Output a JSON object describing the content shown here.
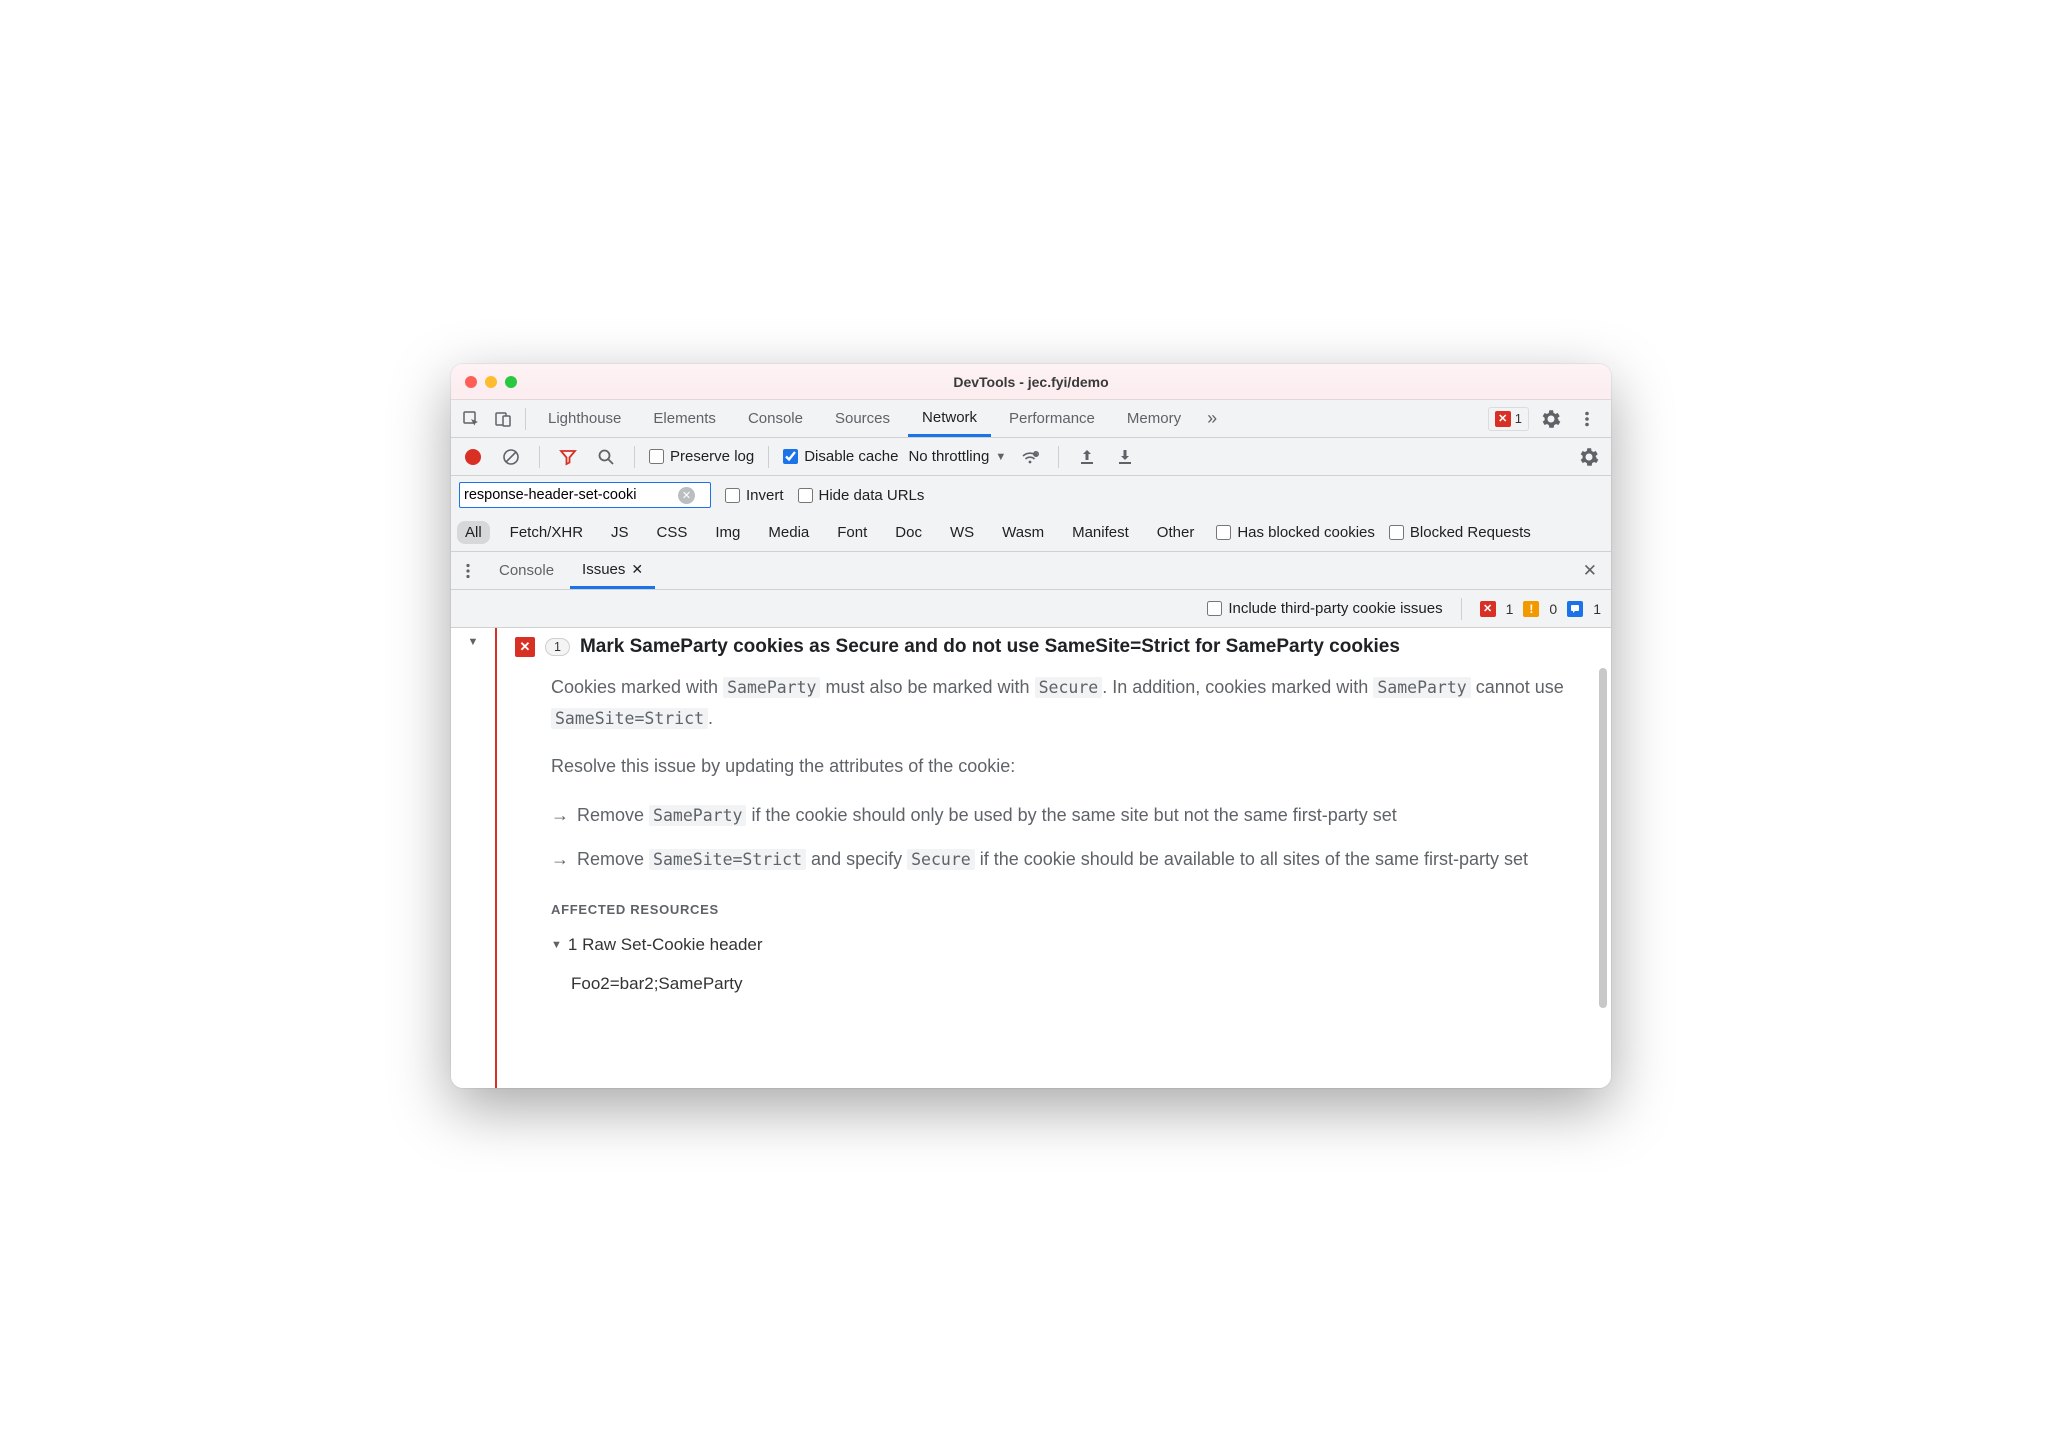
{
  "window": {
    "title": "DevTools - jec.fyi/demo"
  },
  "mainTabs": {
    "items": [
      "Lighthouse",
      "Elements",
      "Console",
      "Sources",
      "Network",
      "Performance",
      "Memory"
    ],
    "active": "Network",
    "overflow_icon": "»",
    "error_count": "1"
  },
  "netToolbar": {
    "preserve_log_label": "Preserve log",
    "preserve_log_checked": false,
    "disable_cache_label": "Disable cache",
    "disable_cache_checked": true,
    "throttling_label": "No throttling"
  },
  "filterBar": {
    "filter_value": "response-header-set-cooki",
    "invert_label": "Invert",
    "invert_checked": false,
    "hide_urls_label": "Hide data URLs",
    "hide_urls_checked": false
  },
  "typeFilters": {
    "items": [
      "All",
      "Fetch/XHR",
      "JS",
      "CSS",
      "Img",
      "Media",
      "Font",
      "Doc",
      "WS",
      "Wasm",
      "Manifest",
      "Other"
    ],
    "active": "All",
    "has_blocked_label": "Has blocked cookies",
    "has_blocked_checked": false,
    "blocked_req_label": "Blocked Requests",
    "blocked_req_checked": false
  },
  "drawer": {
    "tabs": [
      "Console",
      "Issues"
    ],
    "active": "Issues"
  },
  "issuesBar": {
    "include_third_party_label": "Include third-party cookie issues",
    "include_third_party_checked": false,
    "error_count": "1",
    "warning_count": "0",
    "info_count": "1"
  },
  "issue": {
    "count": "1",
    "title": "Mark SameParty cookies as Secure and do not use SameSite=Strict for SameParty cookies",
    "p1_a": "Cookies marked with ",
    "p1_code1": "SameParty",
    "p1_b": " must also be marked with ",
    "p1_code2": "Secure",
    "p1_c": ". In addition, cookies marked with ",
    "p1_code3": "SameParty",
    "p1_d": " cannot use ",
    "p1_code4": "SameSite=Strict",
    "p1_e": ".",
    "p2": "Resolve this issue by updating the attributes of the cookie:",
    "b1_a": "Remove ",
    "b1_code": "SameParty",
    "b1_b": " if the cookie should only be used by the same site but not the same first-party set",
    "b2_a": "Remove ",
    "b2_code1": "SameSite=Strict",
    "b2_b": " and specify ",
    "b2_code2": "Secure",
    "b2_c": " if the cookie should be available to all sites of the same first-party set",
    "affected_heading": "AFFECTED RESOURCES",
    "affected_row": "1 Raw Set-Cookie header",
    "affected_value": "Foo2=bar2;SameParty"
  }
}
